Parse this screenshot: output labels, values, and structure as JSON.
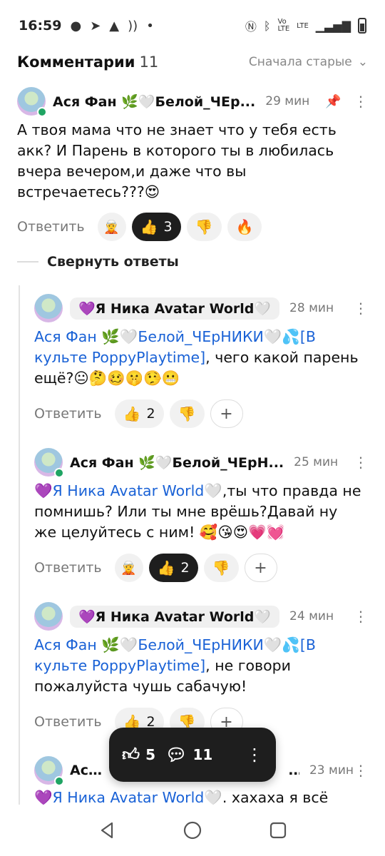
{
  "status_bar": {
    "time": "16:59",
    "icons_left": [
      "chat-icon",
      "telegram-icon",
      "warning-icon",
      "rss-icon",
      "dot-icon"
    ],
    "icons_right": [
      "nfc-icon",
      "bluetooth-icon",
      "volte-icon",
      "signal-lte-icon",
      "signal-icon",
      "battery-icon"
    ],
    "lte": "LTE"
  },
  "header": {
    "title": "Комментарии",
    "count": "11",
    "sort_label": "Сначала старые"
  },
  "comments": [
    {
      "author": "Ася Фан 🌿🤍Белой_ЧЕр...",
      "ago": "29 мин",
      "text": "А твоя мама что не знает что у тебя есть акк? И Парень в которого ты в любилась вчера вечером,и даже что вы встречаетесь???😍",
      "reply_label": "Ответить",
      "like_count": "3"
    },
    {
      "author": "💜Я Ника Avatar World🤍",
      "ago": "28 мин",
      "mention": "Ася Фан 🌿🤍Белой_ЧЕрНИКИ🤍💦[В культе PoppyPlaytime]",
      "text": ", чего какой парень ещё?😐🤔🥴🤫🤥😬",
      "reply_label": "Ответить",
      "like_count": "2"
    },
    {
      "author": "Ася Фан 🌿🤍Белой_ЧЕрН...",
      "ago": "25 мин",
      "mention": "💜Я Ника Avatar World🤍",
      "text": ",ты что правда не помнишь? Или ты мне врёшь?Давай ну же целуйтесь с ним! 🥰😘😍💗💓",
      "reply_label": "Ответить",
      "like_count": "2"
    },
    {
      "author": "💜Я Ника Avatar World🤍",
      "ago": "24 мин",
      "mention": "Ася Фан 🌿🤍Белой_ЧЕрНИКИ🤍💦[В культе PoppyPlaytime]",
      "text": ", не говори пожалуйста чушь сабачую!",
      "reply_label": "Ответить",
      "like_count": "2"
    },
    {
      "author": "Ася Ф",
      "author_tail": "...",
      "ago": "23 мин",
      "mention": "💜Я Ника Avatar World🤍",
      "text": ". хахаха я всё"
    }
  ],
  "collapse_label": "Свернуть ответы",
  "floating_bar": {
    "likes": "5",
    "comments": "11"
  }
}
